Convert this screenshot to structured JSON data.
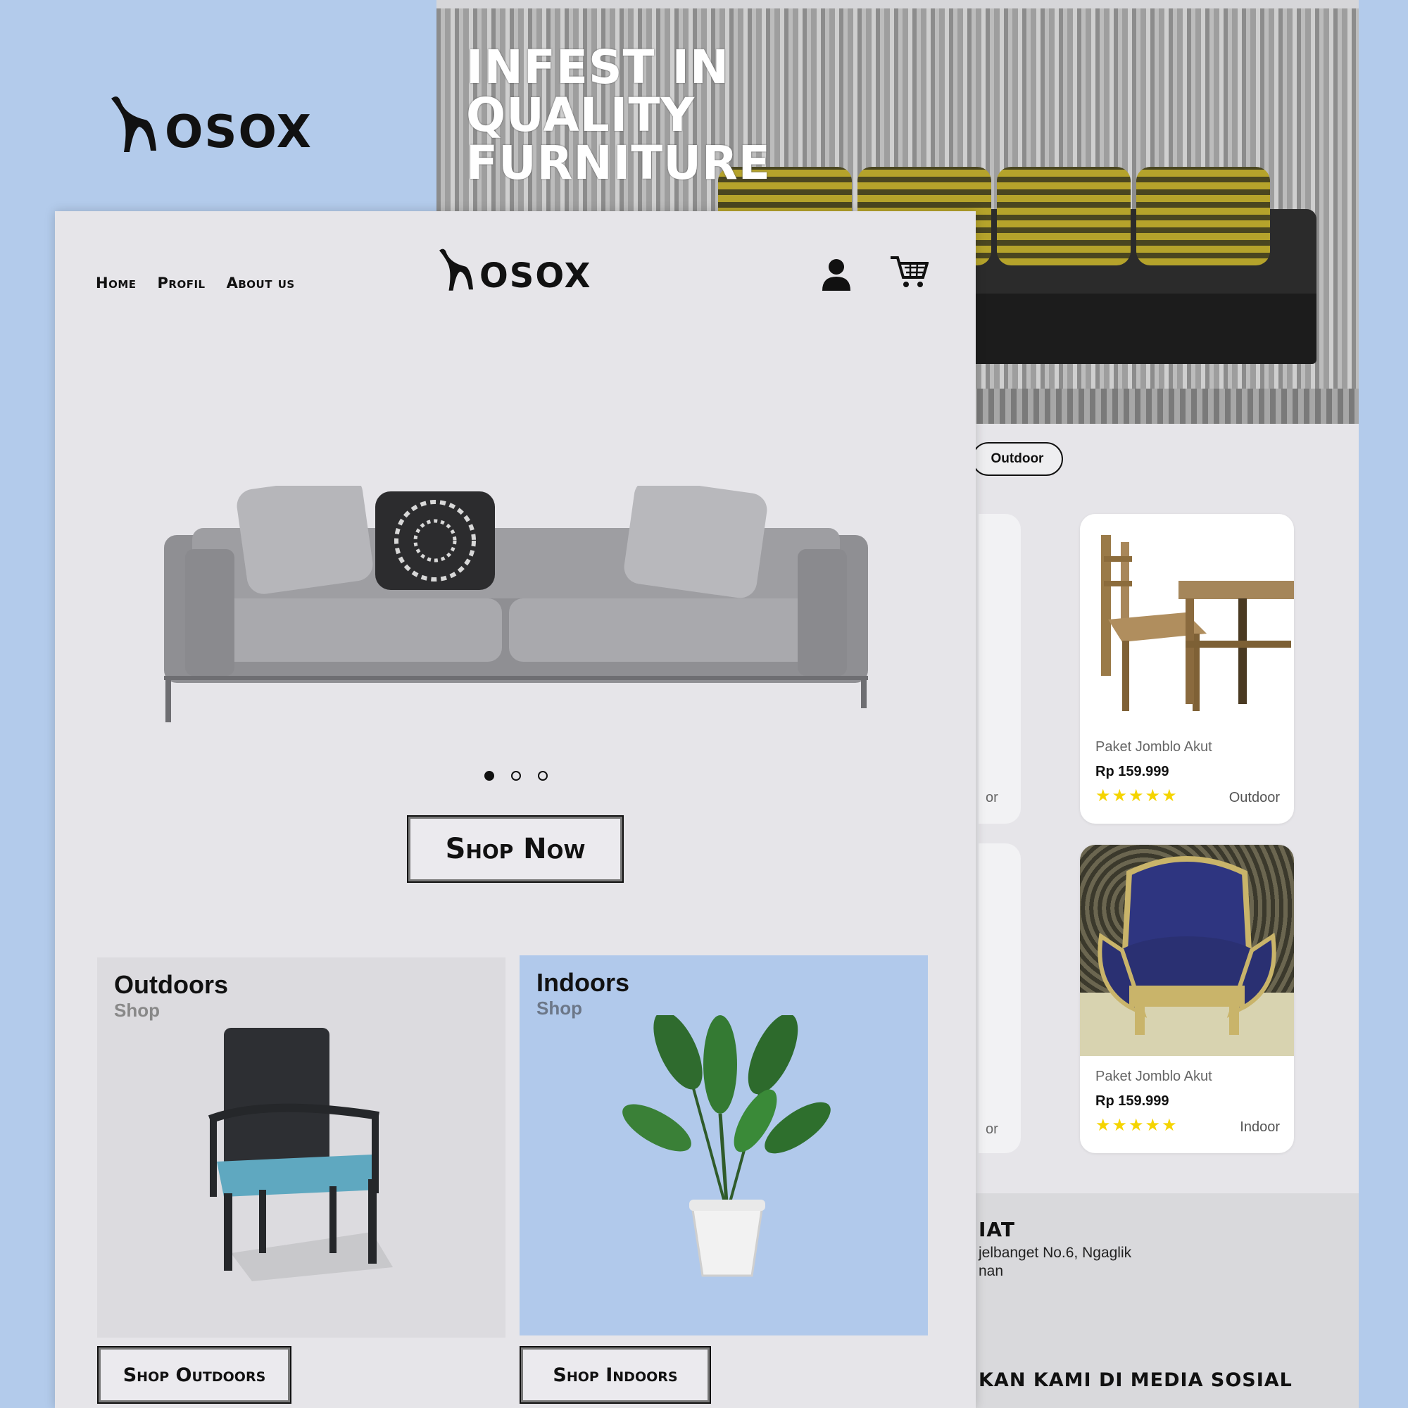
{
  "brand": {
    "name": "OSOX",
    "mark": "ʜ"
  },
  "back_page": {
    "hero_title_lines": [
      "INFEST IN",
      "QUALITY",
      "FURNITURE"
    ],
    "active_tab": "Outdoor",
    "products": [
      {
        "name": "Paket Jomblo Akut",
        "price": "Rp 159.999",
        "stars": "★★★★★",
        "category": "Outdoor"
      },
      {
        "name": "Paket Jomblo Akut",
        "price": "Rp 159.999",
        "stars": "★★★★★",
        "category": "Indoor"
      }
    ],
    "ghost_labels": [
      "or",
      "or"
    ],
    "footer": {
      "heading": "IAT",
      "address_lines": [
        "jelbanget No.6, Ngaglik",
        "nan"
      ],
      "social": "KAN KAMI DI MEDIA SOSIAL"
    }
  },
  "front_page": {
    "nav": [
      "Home",
      "Profil",
      "About us"
    ],
    "carousel": {
      "slides": 3,
      "active": 1
    },
    "shop_now_label": "Shop Now",
    "categories": {
      "outdoor": {
        "title": "Outdoors",
        "subtitle": "Shop",
        "button": "Shop Outdoors"
      },
      "indoor": {
        "title": "Indoors",
        "subtitle": "Shop",
        "button": "Shop Indoors"
      }
    }
  },
  "colors": {
    "background": "#b3cbeb",
    "page": "#e6e5e9",
    "indoor_panel": "#b1c9eb",
    "star": "#f5d400"
  }
}
